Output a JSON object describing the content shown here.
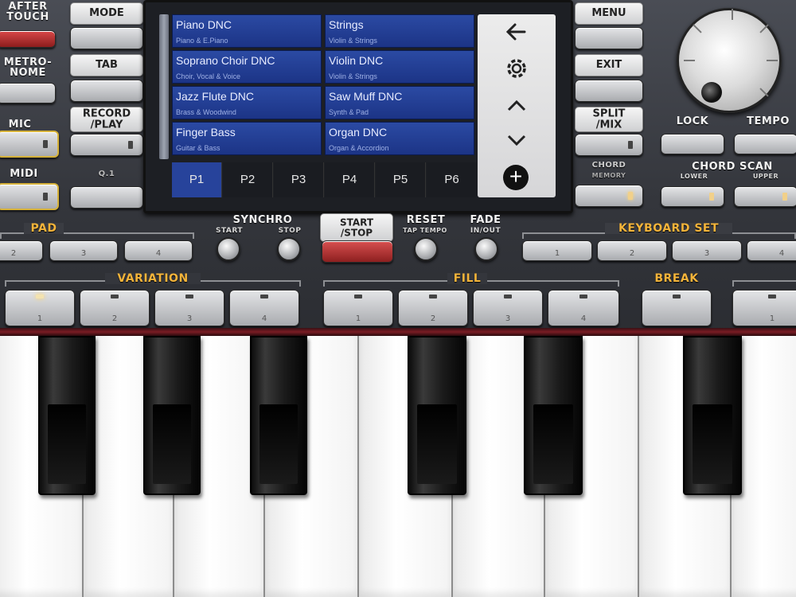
{
  "left_column": {
    "after_touch": "AFTER\nTOUCH",
    "metronome": "METRO-\nNOME",
    "mic": "MIC",
    "midi": "MIDI"
  },
  "left_buttons": {
    "mode": "MODE",
    "tab": "TAB",
    "record_play": "RECORD\n/PLAY",
    "q1": "Q.1"
  },
  "display": {
    "styles": [
      {
        "name": "Piano DNC",
        "category": "Piano & E.Piano"
      },
      {
        "name": "Strings",
        "category": "Violin & Strings"
      },
      {
        "name": "Soprano Choir DNC",
        "category": "Choir, Vocal & Voice"
      },
      {
        "name": "Violin DNC",
        "category": "Violin & Strings"
      },
      {
        "name": "Jazz Flute DNC",
        "category": "Brass & Woodwind"
      },
      {
        "name": "Saw Muff DNC",
        "category": "Synth & Pad"
      },
      {
        "name": "Finger Bass",
        "category": "Guitar & Bass"
      },
      {
        "name": "Organ DNC",
        "category": "Organ & Accordion"
      }
    ],
    "pages": [
      "P1",
      "P2",
      "P3",
      "P4",
      "P5",
      "P6"
    ],
    "active_page": "P1",
    "menu_icons": [
      "back-arrow-icon",
      "gear-icon",
      "chevron-up-icon",
      "chevron-down-icon",
      "plus-icon"
    ]
  },
  "right_buttons": {
    "menu": "MENU",
    "exit": "EXIT",
    "split_mix": "SPLIT\n/MIX",
    "chord_memory": "CHORD",
    "chord_memory_sub": "MEMORY"
  },
  "dial_labels": {
    "lock": "LOCK",
    "tempo": "TEMPO",
    "chord_scan": "CHORD SCAN",
    "lower": "LOWER",
    "upper": "UPPER"
  },
  "transport": {
    "sync": "SYNCHRO",
    "sync_start": "START",
    "sync_stop": "STOP",
    "start_stop": "START\n/STOP",
    "reset": "RESET",
    "reset_sub": "TAP TEMPO",
    "fade": "FADE",
    "fade_sub": "IN/OUT"
  },
  "sections": {
    "pad": "PAD",
    "keyboard_set": "KEYBOARD SET",
    "variation": "VARIATION",
    "fill": "FILL",
    "break": "BREAK"
  },
  "pad_numbers": [
    "2",
    "3",
    "4"
  ],
  "keyboard_set_numbers": [
    "1",
    "2",
    "3",
    "4"
  ],
  "variation_numbers": [
    "1",
    "2",
    "3",
    "4"
  ],
  "fill_numbers": [
    "1",
    "2",
    "3",
    "4"
  ],
  "ending_numbers": [
    "1"
  ],
  "colors": {
    "display_blue": "#2b4aa3",
    "accent_amber": "#f4b43a",
    "start_red": "#b02a2a"
  }
}
